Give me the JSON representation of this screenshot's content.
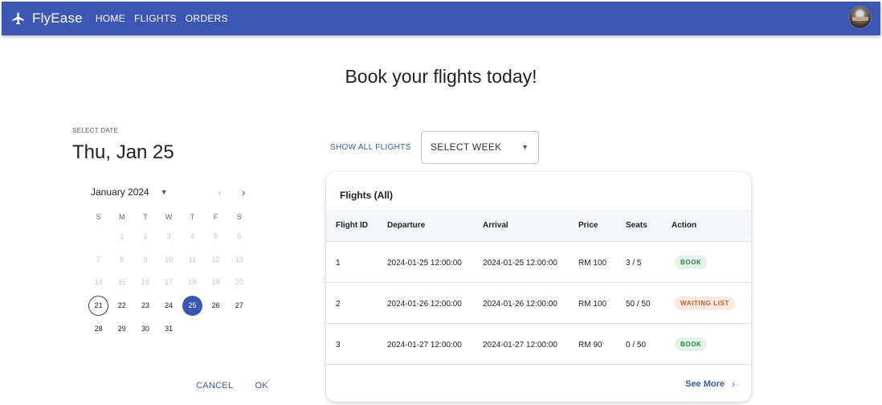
{
  "appbar": {
    "brand": "FlyEase",
    "brand_icon": "airplane-icon",
    "nav": [
      "HOME",
      "FLIGHTS",
      "ORDERS"
    ],
    "background": "#3b57b3"
  },
  "page": {
    "title": "Book your flights today!"
  },
  "date_picker": {
    "eyebrow": "SELECT DATE",
    "selected_label": "Thu, Jan 25",
    "month_label": "January 2024",
    "weekdays": [
      "S",
      "M",
      "T",
      "W",
      "T",
      "F",
      "S"
    ],
    "weeks": [
      [
        "",
        "1",
        "2",
        "3",
        "4",
        "5",
        "6"
      ],
      [
        "7",
        "8",
        "9",
        "10",
        "11",
        "12",
        "13"
      ],
      [
        "14",
        "15",
        "16",
        "17",
        "18",
        "19",
        "20"
      ],
      [
        "21",
        "22",
        "23",
        "24",
        "25",
        "26",
        "27"
      ],
      [
        "28",
        "29",
        "30",
        "31",
        "",
        "",
        ""
      ]
    ],
    "today": "21",
    "selected": "25",
    "disabled_before": 21,
    "cancel_label": "CANCEL",
    "ok_label": "OK"
  },
  "toolbar": {
    "show_all_label": "SHOW ALL FLIGHTS",
    "week_select_value": "SELECT WEEK"
  },
  "flights": {
    "title": "Flights (All)",
    "columns": [
      "Flight ID",
      "Departure",
      "Arrival",
      "Price",
      "Seats",
      "Action"
    ],
    "rows": [
      {
        "id": "1",
        "departure": "2024-01-25 12:00:00",
        "arrival": "2024-01-25 12:00:00",
        "price": "RM 100",
        "seats": "3 / 5",
        "action": "BOOK",
        "action_type": "book"
      },
      {
        "id": "2",
        "departure": "2024-01-26 12:00:00",
        "arrival": "2024-01-26 12:00:00",
        "price": "RM 100",
        "seats": "50 / 50",
        "action": "WAITING LIST",
        "action_type": "wait"
      },
      {
        "id": "3",
        "departure": "2024-01-27 12:00:00",
        "arrival": "2024-01-27 12:00:00",
        "price": "RM 90",
        "seats": "0 / 50",
        "action": "BOOK",
        "action_type": "book"
      }
    ],
    "see_more_label": "See More"
  }
}
